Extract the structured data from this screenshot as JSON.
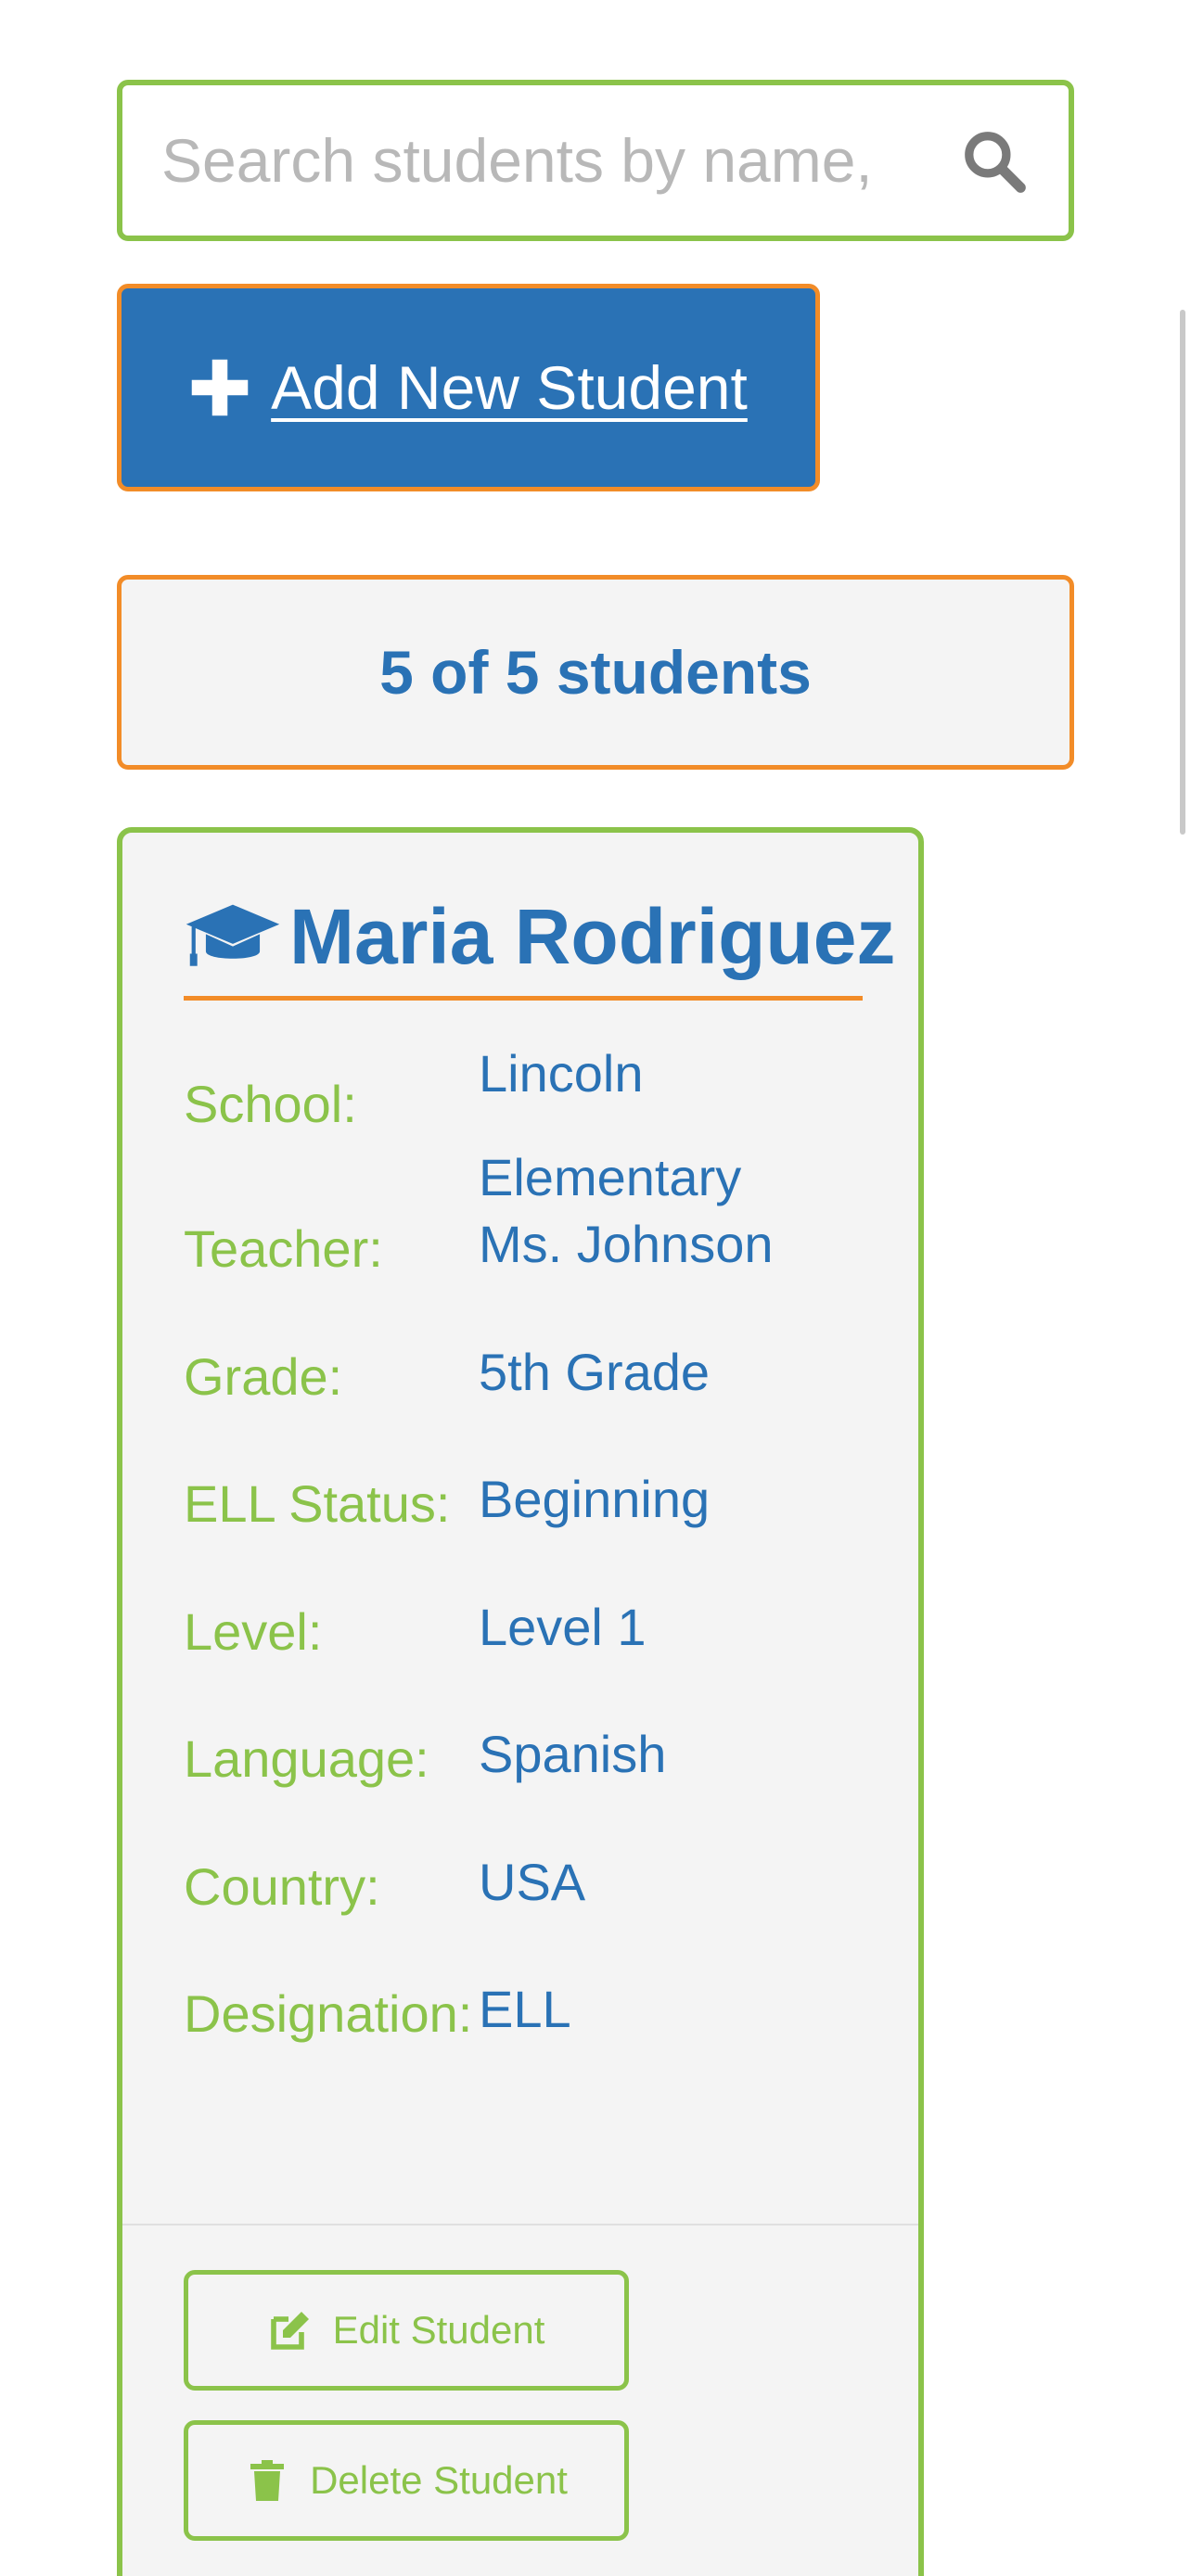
{
  "search": {
    "placeholder": "Search students by name, ",
    "value": ""
  },
  "toolbar": {
    "add_label": "Add New Student"
  },
  "summary": {
    "count_text": "5 of 5 students"
  },
  "student": {
    "name": "Maria Rodriguez",
    "fields": [
      {
        "label": "School:",
        "value": "Lincoln Elementary"
      },
      {
        "label": "Teacher:",
        "value": "Ms. Johnson"
      },
      {
        "label": "Grade:",
        "value": "5th Grade"
      },
      {
        "label": "ELL Status:",
        "value": "Beginning"
      },
      {
        "label": "Level:",
        "value": "Level 1"
      },
      {
        "label": "Language:",
        "value": "Spanish"
      },
      {
        "label": "Country:",
        "value": "USA"
      },
      {
        "label": "Designation:",
        "value": "ELL"
      }
    ],
    "actions": {
      "edit_label": "Edit Student",
      "delete_label": "Delete Student"
    }
  },
  "icons": {
    "search": "search-icon",
    "add": "plus-icon",
    "student": "graduation-cap-icon",
    "edit": "edit-icon",
    "delete": "trash-icon"
  },
  "colors": {
    "primary_blue": "#2a72b5",
    "accent_green": "#8bc34a",
    "accent_orange": "#f28c28",
    "card_background": "#f4f4f4"
  }
}
